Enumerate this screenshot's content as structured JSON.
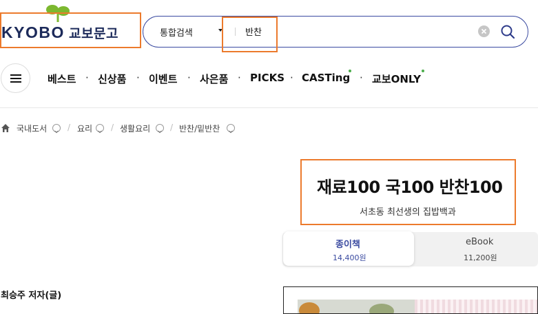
{
  "header": {
    "logo_en": "KYOBO",
    "logo_ko": "교보문고"
  },
  "search": {
    "scope": "통합검색",
    "query": "반찬"
  },
  "nav": {
    "items": [
      "베스트",
      "신상품",
      "이벤트",
      "사은품",
      "PICKS",
      "CASTing",
      "교보ONLY"
    ]
  },
  "breadcrumb": {
    "items": [
      "국내도서",
      "요리",
      "생활요리",
      "반찬/밑반찬"
    ]
  },
  "book": {
    "title": "재료100 국100 반찬100",
    "subtitle": "서초동 최선생의 집밥백과",
    "author": "최승주 저자(글)"
  },
  "formats": [
    {
      "label": "종이책",
      "price": "14,400원"
    },
    {
      "label": "eBook",
      "price": "11,200원"
    }
  ],
  "colors": {
    "brand_navy": "#1c2a5a",
    "search_border": "#3a4aa0",
    "active_tab": "#3a4aa0",
    "highlight": "#ec7a2c",
    "new_dot": "#4cae4c"
  }
}
